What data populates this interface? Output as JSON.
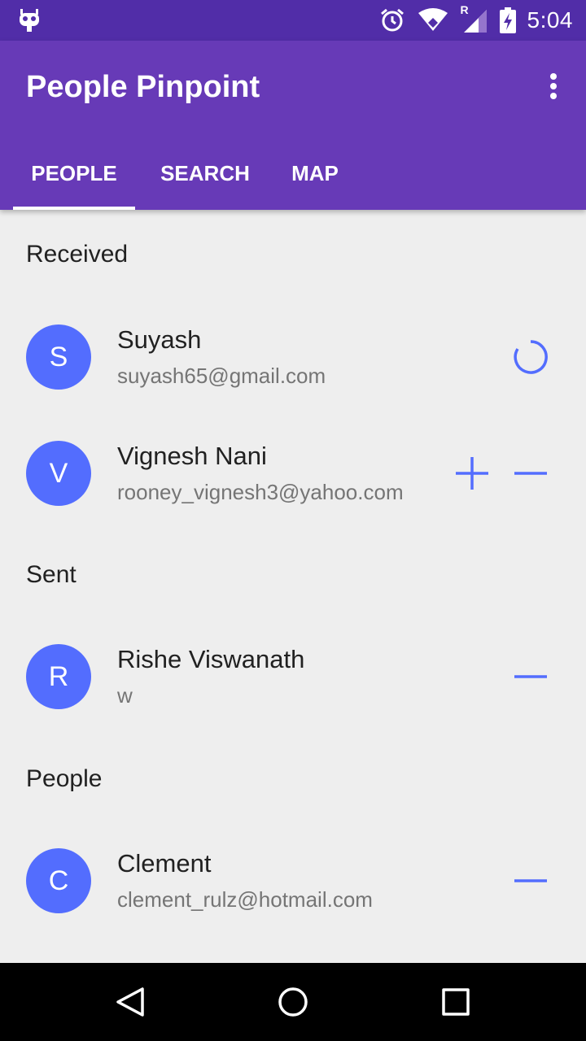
{
  "status_bar": {
    "time": "5:04",
    "icons": [
      "cyanogenmod-icon",
      "alarm-icon",
      "wifi-icon",
      "signal-roaming-icon",
      "battery-charging-icon"
    ],
    "roaming_label": "R"
  },
  "app_bar": {
    "title": "People Pinpoint",
    "menu_icon": "overflow-menu-icon"
  },
  "tabs": [
    {
      "label": "PEOPLE",
      "active": true
    },
    {
      "label": "SEARCH",
      "active": false
    },
    {
      "label": "MAP",
      "active": false
    }
  ],
  "sections": {
    "received": {
      "title": "Received",
      "items": [
        {
          "initial": "S",
          "name": "Suyash",
          "email": "suyash65@gmail.com",
          "action": "loading-spinner-icon"
        },
        {
          "initial": "V",
          "name": "Vignesh Nani",
          "email": "rooney_vignesh3@yahoo.com",
          "actions": [
            "add-icon",
            "remove-icon"
          ]
        }
      ]
    },
    "sent": {
      "title": "Sent",
      "items": [
        {
          "initial": "R",
          "name": "Rishe Viswanath",
          "email": "w",
          "actions": [
            "remove-icon"
          ]
        }
      ]
    },
    "people": {
      "title": "People",
      "items": [
        {
          "initial": "C",
          "name": "Clement",
          "email": "clement_rulz@hotmail.com",
          "actions": [
            "remove-icon"
          ]
        }
      ]
    }
  },
  "colors": {
    "status_bar": "#512da8",
    "app_bar": "#673ab7",
    "accent": "#536dfe",
    "background": "#eeeeee",
    "nav_bar": "#000000"
  },
  "nav_bar": {
    "buttons": [
      "back-icon",
      "home-icon",
      "recents-icon"
    ]
  }
}
